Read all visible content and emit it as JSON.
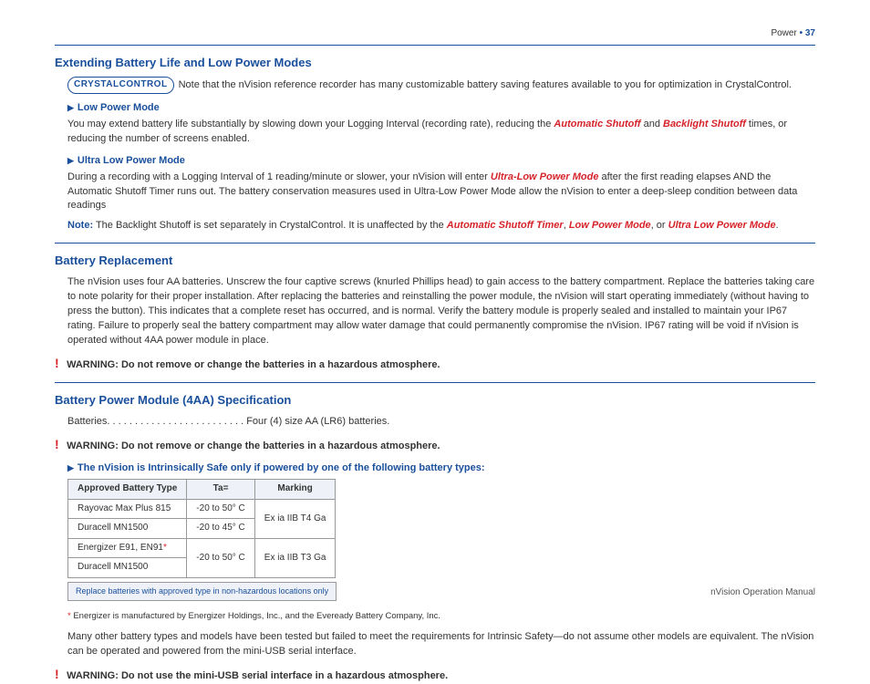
{
  "header": {
    "section": "Power",
    "bullet": "•",
    "page": "37"
  },
  "h1": "Extending Battery Life and Low Power Modes",
  "logo": "CRYSTALCONTROL",
  "intro": "Note that the nVision reference recorder has many customizable battery saving features available to you for optimization in CrystalControl.",
  "lpm": {
    "title": "Low Power Mode",
    "p1a": "You may extend battery life substantially by slowing down your Logging Interval (recording rate), reducing the ",
    "auto": "Automatic Shutoff",
    "and": " and ",
    "back": "Backlight Shutoff",
    "p1b": " times, or reducing the number of screens enabled."
  },
  "ulpm": {
    "title": "Ultra Low Power Mode",
    "p1a": "During a recording with a Logging Interval of 1 reading/minute or slower, your nVision will enter ",
    "mode": "Ultra-Low Power Mode",
    "p1b": " after the first reading elapses AND the Automatic Shutoff Timer runs out. The battery conservation measures used in Ultra-Low Power Mode allow the nVision to enter a deep-sleep condition between data readings"
  },
  "note": {
    "label": "Note:",
    "a": " The Backlight Shutoff is set separately in CrystalControl. It is unaffected by the ",
    "t1": "Automatic Shutoff Timer",
    "c1": ", ",
    "t2": "Low Power Mode",
    "c2": ", or ",
    "t3": "Ultra Low Power Mode",
    "c3": "."
  },
  "h2": "Battery Replacement",
  "br_p": "The nVision uses four AA batteries. Unscrew the four captive screws (knurled Phillips head) to gain access to the battery compartment. Replace the batteries taking care to note polarity for their proper installation. After replacing the batteries and reinstalling the power module, the nVision will start operating immediately (without having to press the button). This indicates that a complete reset has occurred, and is normal. Verify the battery module is properly sealed and installed to maintain your IP67 rating. Failure to properly seal the battery compartment may allow water damage that could permanently compromise the nVision. IP67 rating will be void if nVision is operated without 4AA power module in place.",
  "warn": {
    "label": "WARNING:",
    "w1": " Do not remove or change the batteries in a hazardous atmosphere.",
    "w2": " Do not remove or change the batteries in a hazardous atmosphere.",
    "w3": " Do not use the mini-USB serial interface in a hazardous atmosphere."
  },
  "h3": "Battery Power Module (4AA) Specification",
  "spec_line": "Batteries. . . . . . . . . . . . . . . . . . . . . . . . . Four (4) size AA (LR6) batteries.",
  "safe_title": "The nVision is Intrinsically Safe only if powered by one of the following battery types:",
  "table": {
    "h1": "Approved Battery Type",
    "h2": "Ta=",
    "h3": "Marking",
    "r1c1": "Rayovac Max Plus 815",
    "r1c2": "-20 to 50° C",
    "r2c1": "Duracell MN1500",
    "r2c2": "-20 to 45° C",
    "m1": "Ex ia IIB T4 Ga",
    "r3c1": "Energizer E91, EN91",
    "r3c2": "-20 to 50° C",
    "r4c1": "Duracell MN1500",
    "m2": "Ex ia IIB T3 Ga",
    "note": "Replace batteries with approved type in non-hazardous locations only"
  },
  "asterisk": "*",
  "fn": " Energizer is manufactured by Energizer Holdings, Inc., and the Eveready Battery Company, Inc.",
  "closing": "Many other battery types and models have been tested but failed to meet the requirements for Intrinsic Safety—do not assume other models are equivalent. The nVision can be operated and powered from the mini-USB serial interface.",
  "footer": "nVision Operation Manual"
}
